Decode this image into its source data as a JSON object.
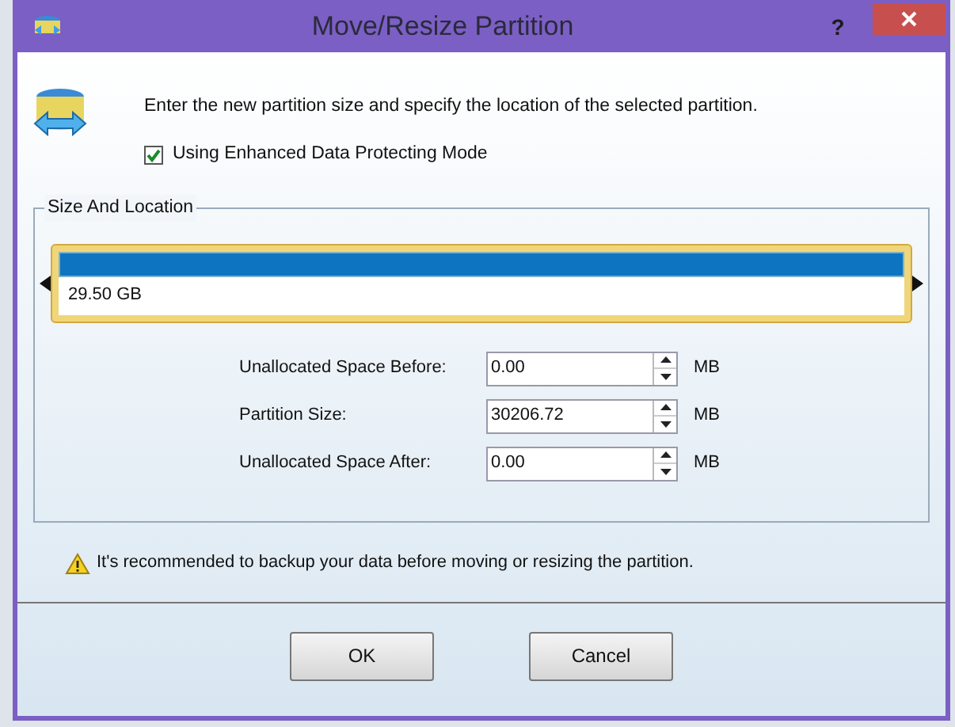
{
  "window": {
    "title": "Move/Resize Partition",
    "help": "?"
  },
  "description": "Enter the new partition size and specify the location of the selected partition.",
  "protect_mode": {
    "label": "Using Enhanced Data Protecting Mode",
    "checked": true
  },
  "size_and_location": {
    "title": "Size And Location",
    "partition_map": {
      "label": "29.50 GB",
      "level": 1
    },
    "fields": [
      {
        "label": "Unallocated Space Before:",
        "value": "0.00",
        "unit": "MB"
      },
      {
        "label": "Partition Size:",
        "value": "30206.72",
        "unit": "MB"
      },
      {
        "label": "Unallocated Space After:",
        "value": "0.00",
        "unit": "MB"
      }
    ]
  },
  "warning": "It's recommended to backup your data before moving or resizing the partition.",
  "buttons": [
    "OK",
    "Cancel"
  ]
}
